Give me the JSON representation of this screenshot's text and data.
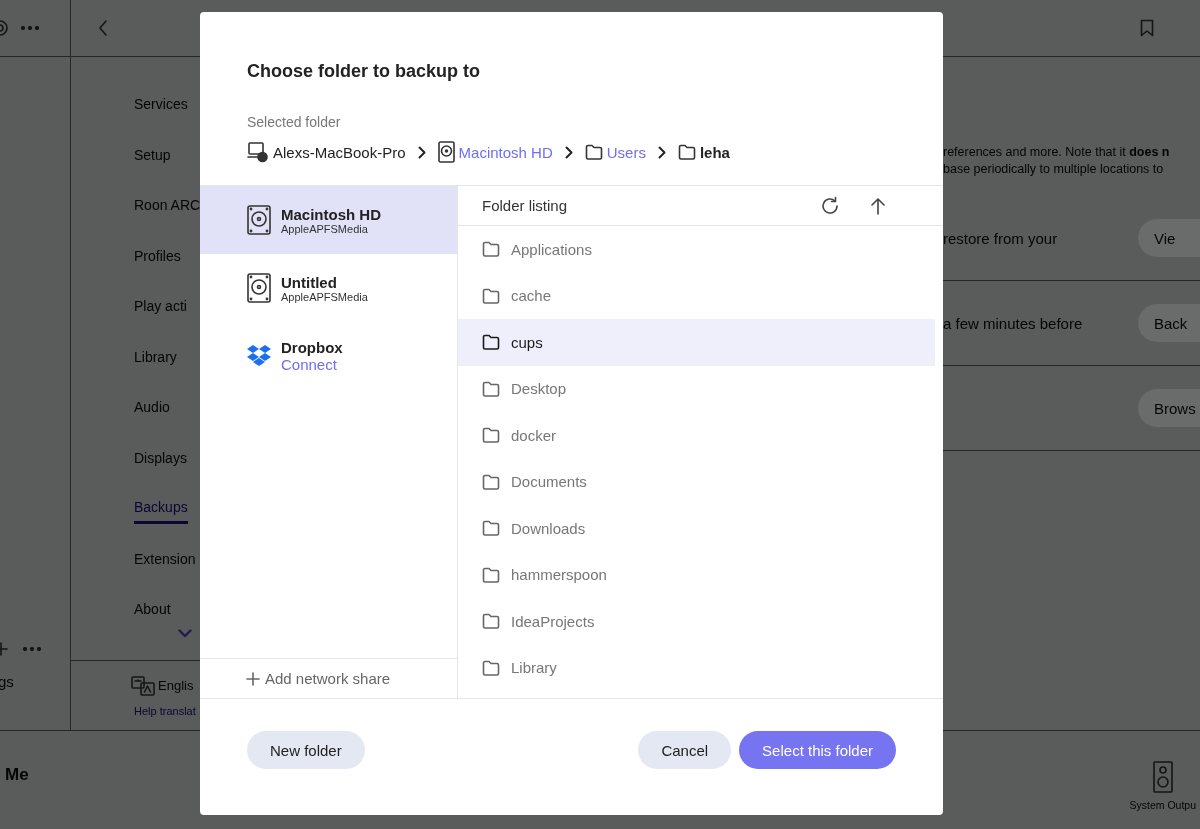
{
  "app": {
    "nav": {
      "items": [
        {
          "label": "Services",
          "selected": false
        },
        {
          "label": "Setup",
          "selected": false
        },
        {
          "label": "Roon ARC",
          "selected": false
        },
        {
          "label": "Profiles",
          "selected": false
        },
        {
          "label": "Play acti",
          "selected": false
        },
        {
          "label": "Library",
          "selected": false
        },
        {
          "label": "Audio",
          "selected": false
        },
        {
          "label": "Displays",
          "selected": false
        },
        {
          "label": "Backups",
          "selected": true
        },
        {
          "label": "Extension",
          "selected": false
        },
        {
          "label": "About",
          "selected": false
        }
      ],
      "language": "Englis",
      "help_link": "Help translat"
    },
    "rail_label": "gs",
    "content": {
      "intro": [
        "references and more. Note that it **does n**",
        "base periodically to multiple locations to"
      ],
      "rows": [
        {
          "text": "restore from your",
          "button": "Vie"
        },
        {
          "text": "a few minutes before",
          "button": "Back"
        },
        {
          "text": "",
          "button": "Brows"
        }
      ]
    },
    "bottom_bar": {
      "profile": "Me",
      "output": "System Outpu"
    }
  },
  "dialog": {
    "title": "Choose folder to backup to",
    "selected_label": "Selected folder",
    "breadcrumb": [
      {
        "kind": "computer",
        "label": "Alexs-MacBook-Pro",
        "link": false
      },
      {
        "kind": "drive",
        "label": "Macintosh HD",
        "link": true
      },
      {
        "kind": "folder",
        "label": "Users",
        "link": true
      },
      {
        "kind": "folder",
        "label": "leha",
        "link": false
      }
    ],
    "sources": [
      {
        "kind": "drive",
        "name": "Macintosh HD",
        "subtitle": "AppleAPFSMedia",
        "selected": true
      },
      {
        "kind": "drive",
        "name": "Untitled",
        "subtitle": "AppleAPFSMedia",
        "selected": false
      },
      {
        "kind": "cloud",
        "name": "Dropbox",
        "action": "Connect",
        "selected": false
      }
    ],
    "add_share": "Add network share",
    "listing_title": "Folder listing",
    "folders": [
      {
        "name": "Applications",
        "selected": false
      },
      {
        "name": "cache",
        "selected": false
      },
      {
        "name": "cups",
        "selected": true
      },
      {
        "name": "Desktop",
        "selected": false
      },
      {
        "name": "docker",
        "selected": false
      },
      {
        "name": "Documents",
        "selected": false
      },
      {
        "name": "Downloads",
        "selected": false
      },
      {
        "name": "hammerspoon",
        "selected": false
      },
      {
        "name": "IdeaProjects",
        "selected": false
      },
      {
        "name": "Library",
        "selected": false
      }
    ],
    "buttons": {
      "new_folder": "New folder",
      "cancel": "Cancel",
      "confirm": "Select this folder"
    }
  }
}
